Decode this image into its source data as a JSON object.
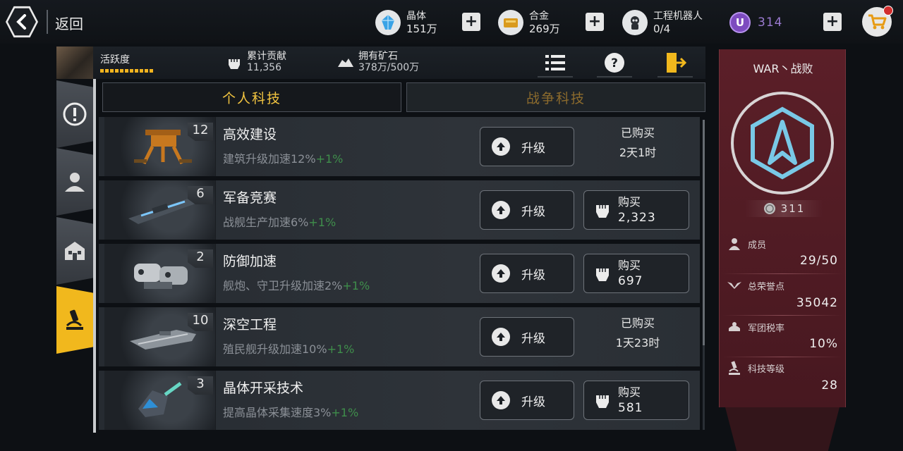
{
  "topbar": {
    "back_label": "返回",
    "resources": [
      {
        "name": "晶体",
        "value": "151万",
        "icon": "crystal-icon"
      },
      {
        "name": "合金",
        "value": "269万",
        "icon": "alloy-icon"
      },
      {
        "name": "工程机器人",
        "value": "0/4",
        "icon": "robot-icon"
      }
    ],
    "premium": {
      "symbol": "U",
      "value": "314"
    }
  },
  "infostrip": {
    "activity_label": "活跃度",
    "contribution_label": "累计贡献",
    "contribution_value": "11,356",
    "mine_label": "拥有矿石",
    "mine_value": "378万/500万"
  },
  "tabs": {
    "personal": "个人科技",
    "war": "战争科技"
  },
  "tech_rows": [
    {
      "level": "12",
      "title": "高效建设",
      "desc": "建筑升级加速12%",
      "bonus": "+1%",
      "upgrade": "升级",
      "status": "已购买",
      "time": "2天1时"
    },
    {
      "level": "6",
      "title": "军备竞赛",
      "desc": "战舰生产加速6%",
      "bonus": "+1%",
      "upgrade": "升级",
      "buy": "购买",
      "cost": "2,323"
    },
    {
      "level": "2",
      "title": "防御加速",
      "desc": "舰炮、守卫升级加速2%",
      "bonus": "+1%",
      "upgrade": "升级",
      "buy": "购买",
      "cost": "697"
    },
    {
      "level": "10",
      "title": "深空工程",
      "desc": "殖民舰升级加速10%",
      "bonus": "+1%",
      "upgrade": "升级",
      "status": "已购买",
      "time": "1天23时"
    },
    {
      "level": "3",
      "title": "晶体开采技术",
      "desc": "提高晶体采集速度3%",
      "bonus": "+1%",
      "upgrade": "升级",
      "buy": "购买",
      "cost": "581"
    }
  ],
  "legion": {
    "name": "WAR丶战败",
    "coins": "311",
    "stats": [
      {
        "label": "成员",
        "value": "29/50",
        "icon": "member-icon"
      },
      {
        "label": "总荣誉点",
        "value": "35042",
        "icon": "wings-icon"
      },
      {
        "label": "军团税率",
        "value": "10%",
        "icon": "tax-icon"
      },
      {
        "label": "科技等级",
        "value": "28",
        "icon": "microscope-icon"
      }
    ]
  },
  "colors": {
    "accent": "#f1b81d",
    "bonus_green": "#3f8e4b",
    "legion_red": "#5b1f28",
    "premium_purple": "#7d4bbf"
  }
}
